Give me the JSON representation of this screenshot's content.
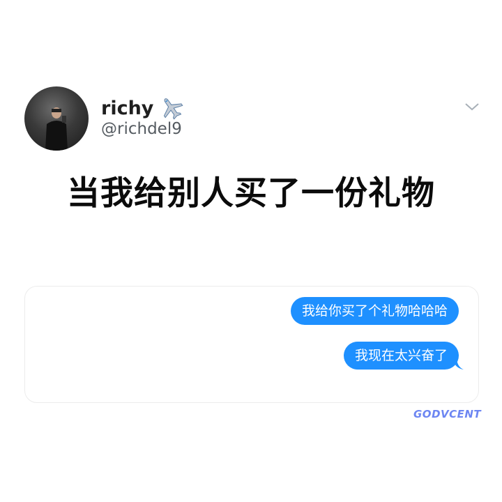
{
  "tweet": {
    "author_name": "richy",
    "author_handle": "@richdel9",
    "name_icon": "airplane-icon",
    "menu_icon": "chevron-down-icon"
  },
  "headline": "当我给别人买了一份礼物",
  "chat": {
    "messages": [
      {
        "text": "我给你买了个礼物哈哈哈",
        "sender": "me"
      },
      {
        "text": "我现在太兴奋了",
        "sender": "me"
      }
    ],
    "bubble_color": "#1e90ff"
  },
  "watermark": "GODVCENT"
}
